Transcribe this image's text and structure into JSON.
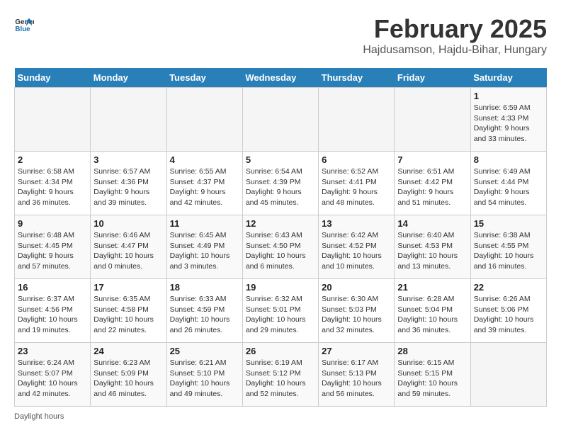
{
  "header": {
    "logo_general": "General",
    "logo_blue": "Blue",
    "month_title": "February 2025",
    "location": "Hajdusamson, Hajdu-Bihar, Hungary"
  },
  "days_of_week": [
    "Sunday",
    "Monday",
    "Tuesday",
    "Wednesday",
    "Thursday",
    "Friday",
    "Saturday"
  ],
  "weeks": [
    [
      {
        "day": "",
        "info": ""
      },
      {
        "day": "",
        "info": ""
      },
      {
        "day": "",
        "info": ""
      },
      {
        "day": "",
        "info": ""
      },
      {
        "day": "",
        "info": ""
      },
      {
        "day": "",
        "info": ""
      },
      {
        "day": "1",
        "info": "Sunrise: 6:59 AM\nSunset: 4:33 PM\nDaylight: 9 hours and 33 minutes."
      }
    ],
    [
      {
        "day": "2",
        "info": "Sunrise: 6:58 AM\nSunset: 4:34 PM\nDaylight: 9 hours and 36 minutes."
      },
      {
        "day": "3",
        "info": "Sunrise: 6:57 AM\nSunset: 4:36 PM\nDaylight: 9 hours and 39 minutes."
      },
      {
        "day": "4",
        "info": "Sunrise: 6:55 AM\nSunset: 4:37 PM\nDaylight: 9 hours and 42 minutes."
      },
      {
        "day": "5",
        "info": "Sunrise: 6:54 AM\nSunset: 4:39 PM\nDaylight: 9 hours and 45 minutes."
      },
      {
        "day": "6",
        "info": "Sunrise: 6:52 AM\nSunset: 4:41 PM\nDaylight: 9 hours and 48 minutes."
      },
      {
        "day": "7",
        "info": "Sunrise: 6:51 AM\nSunset: 4:42 PM\nDaylight: 9 hours and 51 minutes."
      },
      {
        "day": "8",
        "info": "Sunrise: 6:49 AM\nSunset: 4:44 PM\nDaylight: 9 hours and 54 minutes."
      }
    ],
    [
      {
        "day": "9",
        "info": "Sunrise: 6:48 AM\nSunset: 4:45 PM\nDaylight: 9 hours and 57 minutes."
      },
      {
        "day": "10",
        "info": "Sunrise: 6:46 AM\nSunset: 4:47 PM\nDaylight: 10 hours and 0 minutes."
      },
      {
        "day": "11",
        "info": "Sunrise: 6:45 AM\nSunset: 4:49 PM\nDaylight: 10 hours and 3 minutes."
      },
      {
        "day": "12",
        "info": "Sunrise: 6:43 AM\nSunset: 4:50 PM\nDaylight: 10 hours and 6 minutes."
      },
      {
        "day": "13",
        "info": "Sunrise: 6:42 AM\nSunset: 4:52 PM\nDaylight: 10 hours and 10 minutes."
      },
      {
        "day": "14",
        "info": "Sunrise: 6:40 AM\nSunset: 4:53 PM\nDaylight: 10 hours and 13 minutes."
      },
      {
        "day": "15",
        "info": "Sunrise: 6:38 AM\nSunset: 4:55 PM\nDaylight: 10 hours and 16 minutes."
      }
    ],
    [
      {
        "day": "16",
        "info": "Sunrise: 6:37 AM\nSunset: 4:56 PM\nDaylight: 10 hours and 19 minutes."
      },
      {
        "day": "17",
        "info": "Sunrise: 6:35 AM\nSunset: 4:58 PM\nDaylight: 10 hours and 22 minutes."
      },
      {
        "day": "18",
        "info": "Sunrise: 6:33 AM\nSunset: 4:59 PM\nDaylight: 10 hours and 26 minutes."
      },
      {
        "day": "19",
        "info": "Sunrise: 6:32 AM\nSunset: 5:01 PM\nDaylight: 10 hours and 29 minutes."
      },
      {
        "day": "20",
        "info": "Sunrise: 6:30 AM\nSunset: 5:03 PM\nDaylight: 10 hours and 32 minutes."
      },
      {
        "day": "21",
        "info": "Sunrise: 6:28 AM\nSunset: 5:04 PM\nDaylight: 10 hours and 36 minutes."
      },
      {
        "day": "22",
        "info": "Sunrise: 6:26 AM\nSunset: 5:06 PM\nDaylight: 10 hours and 39 minutes."
      }
    ],
    [
      {
        "day": "23",
        "info": "Sunrise: 6:24 AM\nSunset: 5:07 PM\nDaylight: 10 hours and 42 minutes."
      },
      {
        "day": "24",
        "info": "Sunrise: 6:23 AM\nSunset: 5:09 PM\nDaylight: 10 hours and 46 minutes."
      },
      {
        "day": "25",
        "info": "Sunrise: 6:21 AM\nSunset: 5:10 PM\nDaylight: 10 hours and 49 minutes."
      },
      {
        "day": "26",
        "info": "Sunrise: 6:19 AM\nSunset: 5:12 PM\nDaylight: 10 hours and 52 minutes."
      },
      {
        "day": "27",
        "info": "Sunrise: 6:17 AM\nSunset: 5:13 PM\nDaylight: 10 hours and 56 minutes."
      },
      {
        "day": "28",
        "info": "Sunrise: 6:15 AM\nSunset: 5:15 PM\nDaylight: 10 hours and 59 minutes."
      },
      {
        "day": "",
        "info": ""
      }
    ]
  ],
  "footer": {
    "note": "Daylight hours"
  }
}
